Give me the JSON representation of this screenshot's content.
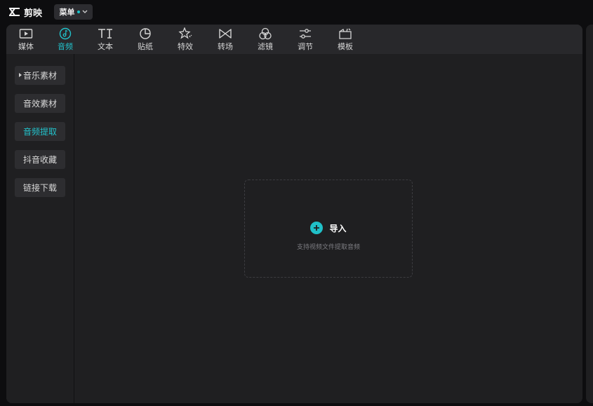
{
  "app": {
    "name": "剪映",
    "menu_label": "菜单"
  },
  "tabs": [
    {
      "label": "媒体",
      "icon": "media-icon",
      "active": false
    },
    {
      "label": "音频",
      "icon": "audio-icon",
      "active": true
    },
    {
      "label": "文本",
      "icon": "text-icon",
      "active": false
    },
    {
      "label": "贴纸",
      "icon": "sticker-icon",
      "active": false
    },
    {
      "label": "特效",
      "icon": "effects-icon",
      "active": false
    },
    {
      "label": "转场",
      "icon": "transition-icon",
      "active": false
    },
    {
      "label": "滤镜",
      "icon": "filter-icon",
      "active": false
    },
    {
      "label": "调节",
      "icon": "adjust-icon",
      "active": false
    },
    {
      "label": "模板",
      "icon": "template-icon",
      "active": false
    }
  ],
  "sidebar": {
    "items": [
      {
        "label": "音乐素材",
        "expandable": true,
        "active": false
      },
      {
        "label": "音效素材",
        "active": false
      },
      {
        "label": "音频提取",
        "active": true
      },
      {
        "label": "抖音收藏",
        "active": false
      },
      {
        "label": "链接下载",
        "active": false
      }
    ]
  },
  "dropzone": {
    "import_label": "导入",
    "hint": "支持视频文件提取音频"
  },
  "colors": {
    "accent": "#22c3cc",
    "background": "#0d0d0f",
    "panel": "#1f1f21",
    "tabbar": "#28282b",
    "sidebar_item": "#2d2d30"
  }
}
